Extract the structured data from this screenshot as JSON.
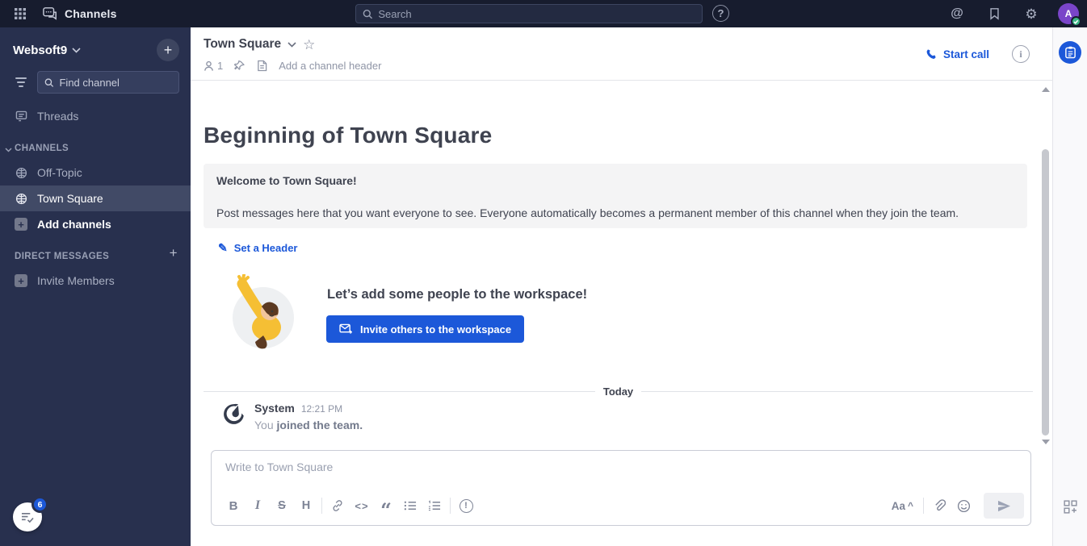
{
  "topbar": {
    "product_label": "Channels",
    "search_placeholder": "Search"
  },
  "icons": {
    "help": "?",
    "at": "@",
    "gear": "⚙",
    "star": "☆",
    "pencil": "✎",
    "info": "i",
    "priority": "!",
    "quote": "“",
    "code": "<>",
    "caret": "^",
    "plus": "+",
    "avatar_initial": "A"
  },
  "sidebar": {
    "team_name": "Websoft9",
    "find_channel_placeholder": "Find channel",
    "threads_label": "Threads",
    "channels_category_label": "CHANNELS",
    "channels": [
      {
        "name": "Off-Topic"
      },
      {
        "name": "Town Square"
      }
    ],
    "add_channels_label": "Add channels",
    "direct_messages_label": "DIRECT MESSAGES",
    "invite_members_label": "Invite Members",
    "tasklist_badge_count": "6"
  },
  "channel_header": {
    "title": "Town Square",
    "member_count": "1",
    "add_header_placeholder": "Add a channel header",
    "start_call_label": "Start call"
  },
  "main": {
    "intro_title": "Beginning of Town Square",
    "welcome_title": "Welcome to Town Square!",
    "welcome_body": "Post messages here that you want everyone to see. Everyone automatically becomes a permanent member of this channel when they join the team.",
    "set_header_label": "Set a Header",
    "invite_heading": "Let’s add some people to the workspace!",
    "invite_button_label": "Invite others to the workspace",
    "date_divider": "Today"
  },
  "message": {
    "sender": "System",
    "timestamp": "12:21 PM",
    "body_prefix": "You",
    "body_emphasis": "joined the team."
  },
  "composer": {
    "placeholder": "Write to Town Square",
    "toolbar": {
      "bold": "B",
      "italic": "I",
      "strike": "S",
      "heading": "H",
      "format_toggle": "Aa"
    }
  },
  "colors": {
    "topbar_bg": "#171C2E",
    "sidebar_bg": "#28304E",
    "accent_blue": "#1C58D9",
    "avatar_purple": "#7A45C9",
    "status_green": "#3DB887"
  }
}
